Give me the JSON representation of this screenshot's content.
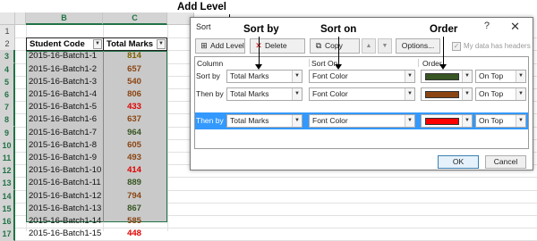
{
  "annotations": {
    "add_level": "Add Level",
    "sort_by": "Sort by",
    "sort_on": "Sort on",
    "order": "Order"
  },
  "sheet": {
    "col_b": "B",
    "col_c": "C",
    "rows": [
      "1",
      "2",
      "3",
      "4",
      "5",
      "6",
      "7",
      "8",
      "9",
      "10",
      "11",
      "12",
      "13",
      "14",
      "15",
      "16",
      "17"
    ],
    "header_student": "Student Code",
    "header_marks": "Total Marks",
    "data": [
      {
        "code": "2015-16-Batch1-1",
        "marks": "814",
        "color": "#7f6000"
      },
      {
        "code": "2015-16-Batch1-2",
        "marks": "657",
        "color": "#8b4513"
      },
      {
        "code": "2015-16-Batch1-3",
        "marks": "540",
        "color": "#8b4513"
      },
      {
        "code": "2015-16-Batch1-4",
        "marks": "806",
        "color": "#8b4513"
      },
      {
        "code": "2015-16-Batch1-5",
        "marks": "433",
        "color": "#e00000"
      },
      {
        "code": "2015-16-Batch1-6",
        "marks": "637",
        "color": "#8b4513"
      },
      {
        "code": "2015-16-Batch1-7",
        "marks": "964",
        "color": "#375623"
      },
      {
        "code": "2015-16-Batch1-8",
        "marks": "605",
        "color": "#8b4513"
      },
      {
        "code": "2015-16-Batch1-9",
        "marks": "493",
        "color": "#8b4513"
      },
      {
        "code": "2015-16-Batch1-10",
        "marks": "414",
        "color": "#e00000"
      },
      {
        "code": "2015-16-Batch1-11",
        "marks": "889",
        "color": "#375623"
      },
      {
        "code": "2015-16-Batch1-12",
        "marks": "794",
        "color": "#8b4513"
      },
      {
        "code": "2015-16-Batch1-13",
        "marks": "867",
        "color": "#375623"
      },
      {
        "code": "2015-16-Batch1-14",
        "marks": "585",
        "color": "#8b4513"
      },
      {
        "code": "2015-16-Batch1-15",
        "marks": "448",
        "color": "#e00000"
      }
    ]
  },
  "dialog": {
    "title": "Sort",
    "help": "?",
    "close": "✕",
    "add_level": "Add Level",
    "delete_level": "Delete Level",
    "copy_level": "Copy Level",
    "options": "Options...",
    "my_data_headers": "My data has headers",
    "col_column": "Column",
    "col_sort_on": "Sort On",
    "col_order": "Order",
    "rows": [
      {
        "label": "Sort by",
        "column": "Total Marks",
        "sort_on": "Font Color",
        "color": "#375623",
        "position": "On Top"
      },
      {
        "label": "Then by",
        "column": "Total Marks",
        "sort_on": "Font Color",
        "color": "#8b4513",
        "position": "On Top"
      },
      {
        "label": "Then by",
        "column": "Total Marks",
        "sort_on": "Font Color",
        "color": "#ff0000",
        "position": "On Top"
      }
    ],
    "ok": "OK",
    "cancel": "Cancel"
  }
}
